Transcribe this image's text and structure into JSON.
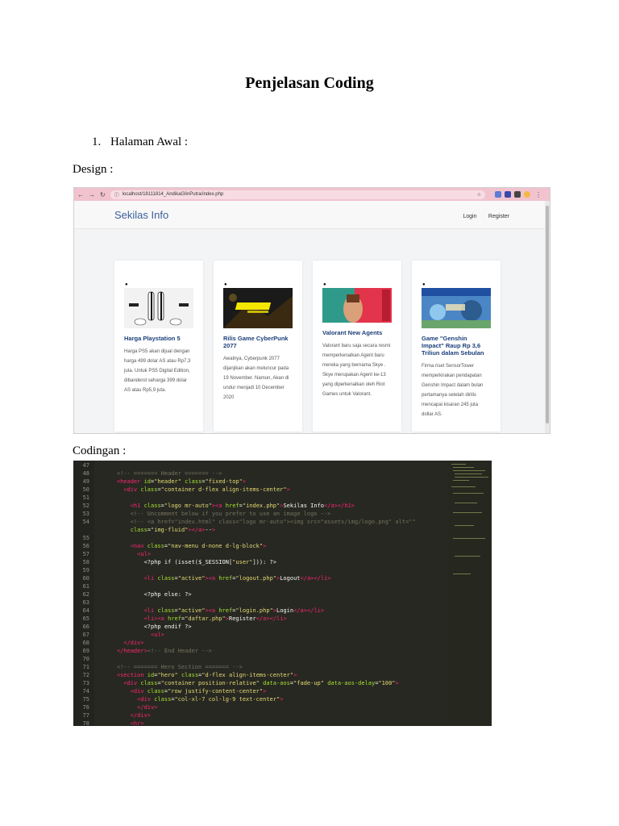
{
  "document": {
    "title": "Penjelasan Coding",
    "section_number": "1.",
    "section_title": "Halaman Awal :",
    "design_label": "Design :",
    "code_label": "Codingan :"
  },
  "browser": {
    "url": "localhost/18111814_AndikaGlinPutra/index.php",
    "site_logo": "Sekilas Info",
    "nav": [
      "Login",
      "Register"
    ],
    "cards": [
      {
        "title": "Harga Playstation 5",
        "text": "Harga PS5 akan dijual dengan harga 499 dolar AS atau Rp7,3 juta. Untuk PS5 Digital Edition, dibanderol seharga 399 dolar AS atau Rp5,9 juta."
      },
      {
        "title": "Rilis Game CyberPunk 2077",
        "text": "Awalnya, Cyberpunk 2077 dijanjikan akan meluncur pada 19 November. Namun, Akan di undur menjadi 10 December 2020"
      },
      {
        "title": "Valorant New Agents",
        "text": "Valorant baru saja secara resmi memperkenalkan Agent baru mereka yang bernama Skye . Skye merupakan Agent ke-13 yang diperkenalkan oleh Riot Games untuk Valorant."
      },
      {
        "title": "Game \"Genshin Impact\" Raup Rp 3,6 Triliun dalam Sebulan",
        "text": "Firma riset SensorTower memperkirakan pendapatan Genshin Impact dalam bulan pertamanya setelah dirilis mencapai kisaran 245 juta dollar AS."
      }
    ]
  },
  "code": {
    "lines": [
      {
        "n": "47",
        "t": ""
      },
      {
        "n": "48",
        "t": "    <!-- ======= Header ======= -->"
      },
      {
        "n": "49",
        "t": "    <header id=\"header\" class=\"fixed-top\">"
      },
      {
        "n": "50",
        "t": "      <div class=\"container d-flex align-items-center\">"
      },
      {
        "n": "51",
        "t": ""
      },
      {
        "n": "52",
        "t": "        <h1 class=\"logo mr-auto\"><a href=\"index.php\">Sekilas Info</a></h1>"
      },
      {
        "n": "53",
        "t": "        <!-- Uncomment below if you prefer to use an image logo -->"
      },
      {
        "n": "54",
        "t": "        <!-- <a href=\"index.html\" class=\"logo mr-auto\"><img src=\"assets/img/logo.png\" alt=\"\""
      },
      {
        "n": "",
        "t": "        class=\"img-fluid\"></a>-->"
      },
      {
        "n": "55",
        "t": ""
      },
      {
        "n": "56",
        "t": "        <nav class=\"nav-menu d-none d-lg-block\">"
      },
      {
        "n": "57",
        "t": "          <ul>"
      },
      {
        "n": "58",
        "t": "            <?php if (isset($_SESSION[\"user\"])): ?>"
      },
      {
        "n": "59",
        "t": ""
      },
      {
        "n": "60",
        "t": "            <li class=\"active\"><a href=\"logout.php\">Logout</a></li>"
      },
      {
        "n": "61",
        "t": ""
      },
      {
        "n": "62",
        "t": "            <?php else: ?>"
      },
      {
        "n": "63",
        "t": ""
      },
      {
        "n": "64",
        "t": "            <li class=\"active\"><a href=\"login.php\">Login</a></li>"
      },
      {
        "n": "65",
        "t": "            <li><a href=\"daftar.php\">Register</a></li>"
      },
      {
        "n": "66",
        "t": "            <?php endif ?>"
      },
      {
        "n": "67",
        "t": "              <ul>"
      },
      {
        "n": "68",
        "t": "      </div>"
      },
      {
        "n": "69",
        "t": "    </header><!-- End Header -->"
      },
      {
        "n": "70",
        "t": ""
      },
      {
        "n": "71",
        "t": "    <!-- ======= Hero Section ======= -->"
      },
      {
        "n": "72",
        "t": "    <section id=\"hero\" class=\"d-flex align-items-center\">"
      },
      {
        "n": "73",
        "t": "      <div class=\"container position-relative\" data-aos=\"fade-up\" data-aos-delay=\"100\">"
      },
      {
        "n": "74",
        "t": "        <div class=\"row justify-content-center\">"
      },
      {
        "n": "75",
        "t": "          <div class=\"col-xl-7 col-lg-9 text-center\">"
      },
      {
        "n": "76",
        "t": "          </div>"
      },
      {
        "n": "77",
        "t": "        </div>"
      },
      {
        "n": "78",
        "t": "        <hr>"
      }
    ]
  },
  "colors": {
    "chrome": "#f1c3cf",
    "logo": "#3b5f99",
    "card_title": "#1b3f7a",
    "code_bg": "#272822",
    "code_text": "#f8f8f2",
    "tag": "#f92672",
    "attr": "#a6e22e",
    "string": "#e6db74",
    "comment": "#75715e"
  }
}
